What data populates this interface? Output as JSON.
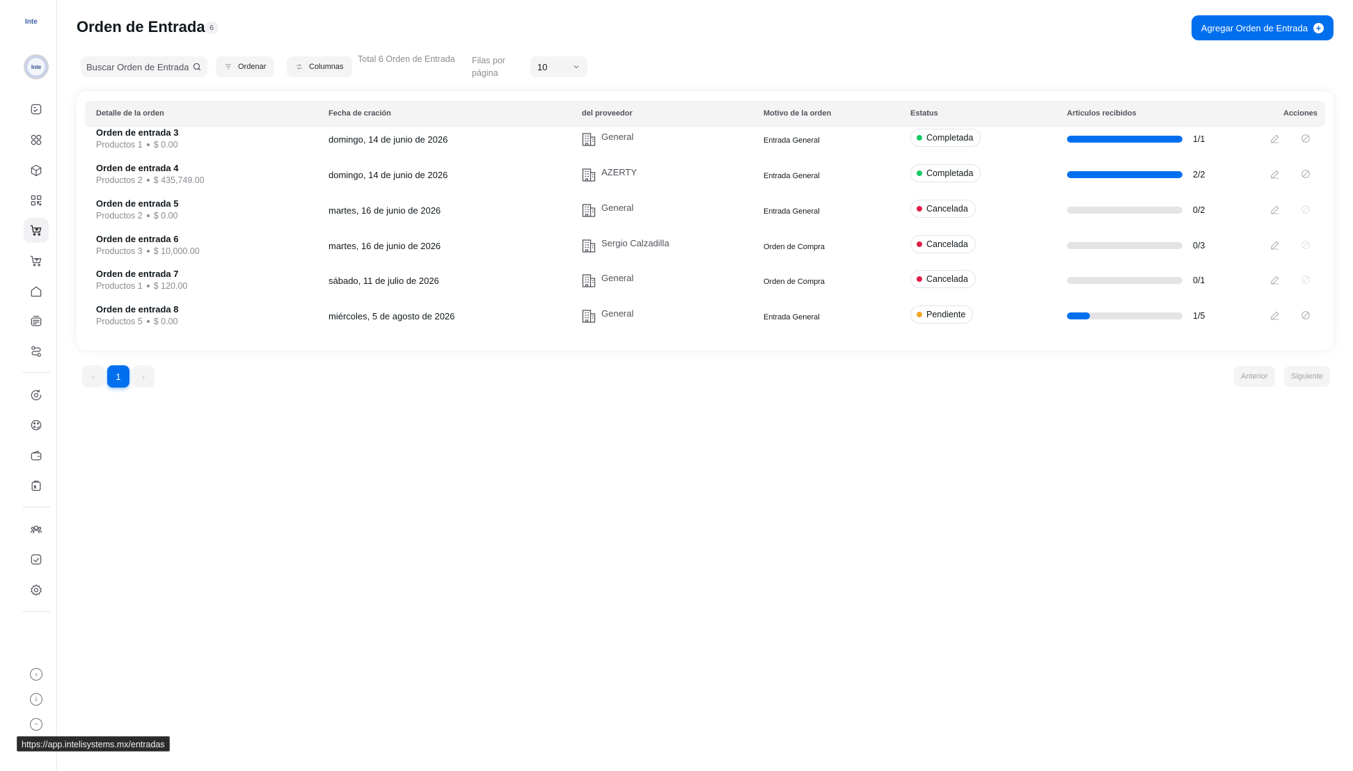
{
  "sidebar": {
    "logo_text": "Inte",
    "avatar_text": "Inte",
    "icons": [
      "dashboard-icon",
      "grid-icon",
      "box-icon",
      "qr-icon",
      "cart-in-icon",
      "cart-out-icon",
      "warehouse-icon",
      "register-icon",
      "route-icon",
      "refresh-icon",
      "palette-icon",
      "wallet-icon",
      "briefcase-icon",
      "users-icon",
      "reports-icon",
      "settings-icon"
    ],
    "bottom": {
      "expand": "›",
      "info": "i",
      "collapse": "−"
    }
  },
  "header": {
    "title": "Orden de Entrada",
    "count": "6",
    "add_button": "Agregar Orden de Entrada"
  },
  "toolbar": {
    "search_placeholder": "Buscar Orden de Entrada",
    "sort_label": "Ordenar",
    "columns_label": "Columnas",
    "total_text": "Total 6 Orden de Entrada",
    "rows_per_page_label": "Filas por página",
    "rows_per_page_value": "10"
  },
  "table": {
    "columns": [
      "Detalle de la orden",
      "Fecha de cración",
      "del proveedor",
      "Motivo de la orden",
      "Estatus",
      "Articulos recibidos",
      "Acciones"
    ],
    "rows": [
      {
        "name": "Orden de entrada 3",
        "products": "Productos 1",
        "amount": "$ 0.00",
        "date": "domingo, 14 de junio de 2026",
        "provider": "General",
        "motivo": "Entrada General",
        "status": "Completada",
        "status_color": "#17c964",
        "received": "1/1",
        "progress": 1.0,
        "cancel_enabled": true
      },
      {
        "name": "Orden de entrada 4",
        "products": "Productos 2",
        "amount": "$ 435,749.00",
        "date": "domingo, 14 de junio de 2026",
        "provider": "AZERTY",
        "motivo": "Entrada General",
        "status": "Completada",
        "status_color": "#17c964",
        "received": "2/2",
        "progress": 1.0,
        "cancel_enabled": true
      },
      {
        "name": "Orden de entrada 5",
        "products": "Productos 2",
        "amount": "$ 0.00",
        "date": "martes, 16 de junio de 2026",
        "provider": "General",
        "motivo": "Entrada General",
        "status": "Cancelada",
        "status_color": "#e11d48",
        "received": "0/2",
        "progress": 0.0,
        "cancel_enabled": false
      },
      {
        "name": "Orden de entrada 6",
        "products": "Productos 3",
        "amount": "$ 10,000.00",
        "date": "martes, 16 de junio de 2026",
        "provider": "Sergio Calzadilla",
        "motivo": "Orden de Compra",
        "status": "Cancelada",
        "status_color": "#e11d48",
        "received": "0/3",
        "progress": 0.0,
        "cancel_enabled": false
      },
      {
        "name": "Orden de entrada 7",
        "products": "Productos 1",
        "amount": "$ 120.00",
        "date": "sábado, 11 de julio de 2026",
        "provider": "General",
        "motivo": "Orden de Compra",
        "status": "Cancelada",
        "status_color": "#e11d48",
        "received": "0/1",
        "progress": 0.0,
        "cancel_enabled": false
      },
      {
        "name": "Orden de entrada 8",
        "products": "Productos 5",
        "amount": "$ 0.00",
        "date": "miércoles, 5 de agosto de 2026",
        "provider": "General",
        "motivo": "Entrada General",
        "status": "Pendiente",
        "status_color": "#f5a524",
        "received": "1/5",
        "progress": 0.2,
        "cancel_enabled": true
      }
    ]
  },
  "pagination": {
    "prev_arrow": "‹",
    "current_page": "1",
    "next_arrow": "›",
    "prev_label": "Anterior",
    "next_label": "Siguiente"
  },
  "status_bar": {
    "url": "https://app.intelisystems.mx/entradas"
  },
  "colors": {
    "accent": "#006fee",
    "success": "#17c964",
    "danger": "#e11d48",
    "warning": "#f5a524"
  }
}
